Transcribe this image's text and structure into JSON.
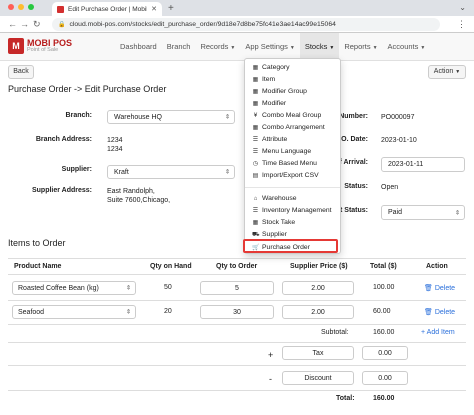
{
  "browser": {
    "tab_title": "Edit Purchase Order | MobiPOS",
    "tab_close": "✕",
    "url": "cloud.mobi-pos.com/stocks/edit_purchase_order/9d18e7d8be75fc41e3ae14ac99e15064"
  },
  "brand": {
    "name": "MOBI POS",
    "sub": "Point of Sale",
    "accent": "#c62828"
  },
  "nav": {
    "items": [
      "Dashboard",
      "Branch",
      "Records",
      "App Settings",
      "Stocks",
      "Reports",
      "Accounts"
    ],
    "active": "Stocks"
  },
  "page": {
    "back_label": "Back",
    "action_label": "Action",
    "title": "Purchase Order -> Edit Purchase Order"
  },
  "form": {
    "branch_label": "Branch:",
    "branch_value": "Warehouse HQ",
    "branch_address_label": "Branch Address:",
    "branch_address_lines": [
      "1234",
      "1234"
    ],
    "supplier_label": "Supplier:",
    "supplier_value": "Kraft",
    "supplier_address_label": "Supplier Address:",
    "supplier_address_lines": [
      "East Randolph,",
      "Suite 7600,Chicago,"
    ],
    "number_label": "Number:",
    "number_value": "PO000097",
    "date_label": "P.O. Date:",
    "date_value": "2023-01-10",
    "arrival_label": "of Arrival:",
    "arrival_value": "2023-01-11",
    "status_label": "Status:",
    "status_value": "Open",
    "payment_status_label": "nt Status:",
    "payment_status_value": "Paid"
  },
  "items_section": {
    "title": "Items to Order",
    "columns": [
      "Product Name",
      "Qty on Hand",
      "Qty to Order",
      "Supplier Price ($)",
      "Total ($)",
      "Action"
    ],
    "rows": [
      {
        "product": "Roasted Coffee Bean (kg)",
        "on_hand": "50",
        "qty": "5",
        "price": "2.00",
        "total": "100.00",
        "action": "Delete"
      },
      {
        "product": "Seafood",
        "on_hand": "20",
        "qty": "30",
        "price": "2.00",
        "total": "60.00",
        "action": "Delete"
      }
    ],
    "subtotal_label": "Subtotal:",
    "subtotal": "160.00",
    "add_item_label": "Add Item",
    "tax_label": "Tax",
    "tax_value": "0.00",
    "tax_sign": "+",
    "discount_label": "Discount",
    "discount_value": "0.00",
    "discount_sign": "-",
    "total_label": "Total:",
    "total": "160.00"
  },
  "stocks_menu": {
    "group1": [
      {
        "label": "Category",
        "icon": "grid-icon"
      },
      {
        "label": "Item",
        "icon": "grid-icon"
      },
      {
        "label": "Modifier Group",
        "icon": "grid-icon"
      },
      {
        "label": "Modifier",
        "icon": "grid-icon"
      },
      {
        "label": "Combo Meal Group",
        "icon": "fork-knife-icon"
      },
      {
        "label": "Combo Arrangement",
        "icon": "grid-icon"
      },
      {
        "label": "Attribute",
        "icon": "list-icon"
      },
      {
        "label": "Menu Language",
        "icon": "list-icon"
      },
      {
        "label": "Time Based Menu",
        "icon": "clock-icon"
      },
      {
        "label": "Import/Export CSV",
        "icon": "file-icon"
      }
    ],
    "group2": [
      {
        "label": "Warehouse",
        "icon": "warehouse-icon"
      },
      {
        "label": "Inventory Management",
        "icon": "list-icon"
      },
      {
        "label": "Stock Take",
        "icon": "grid-icon"
      },
      {
        "label": "Supplier",
        "icon": "truck-icon"
      },
      {
        "label": "Purchase Order",
        "icon": "cart-icon"
      }
    ],
    "highlight_color": "#e53935"
  }
}
